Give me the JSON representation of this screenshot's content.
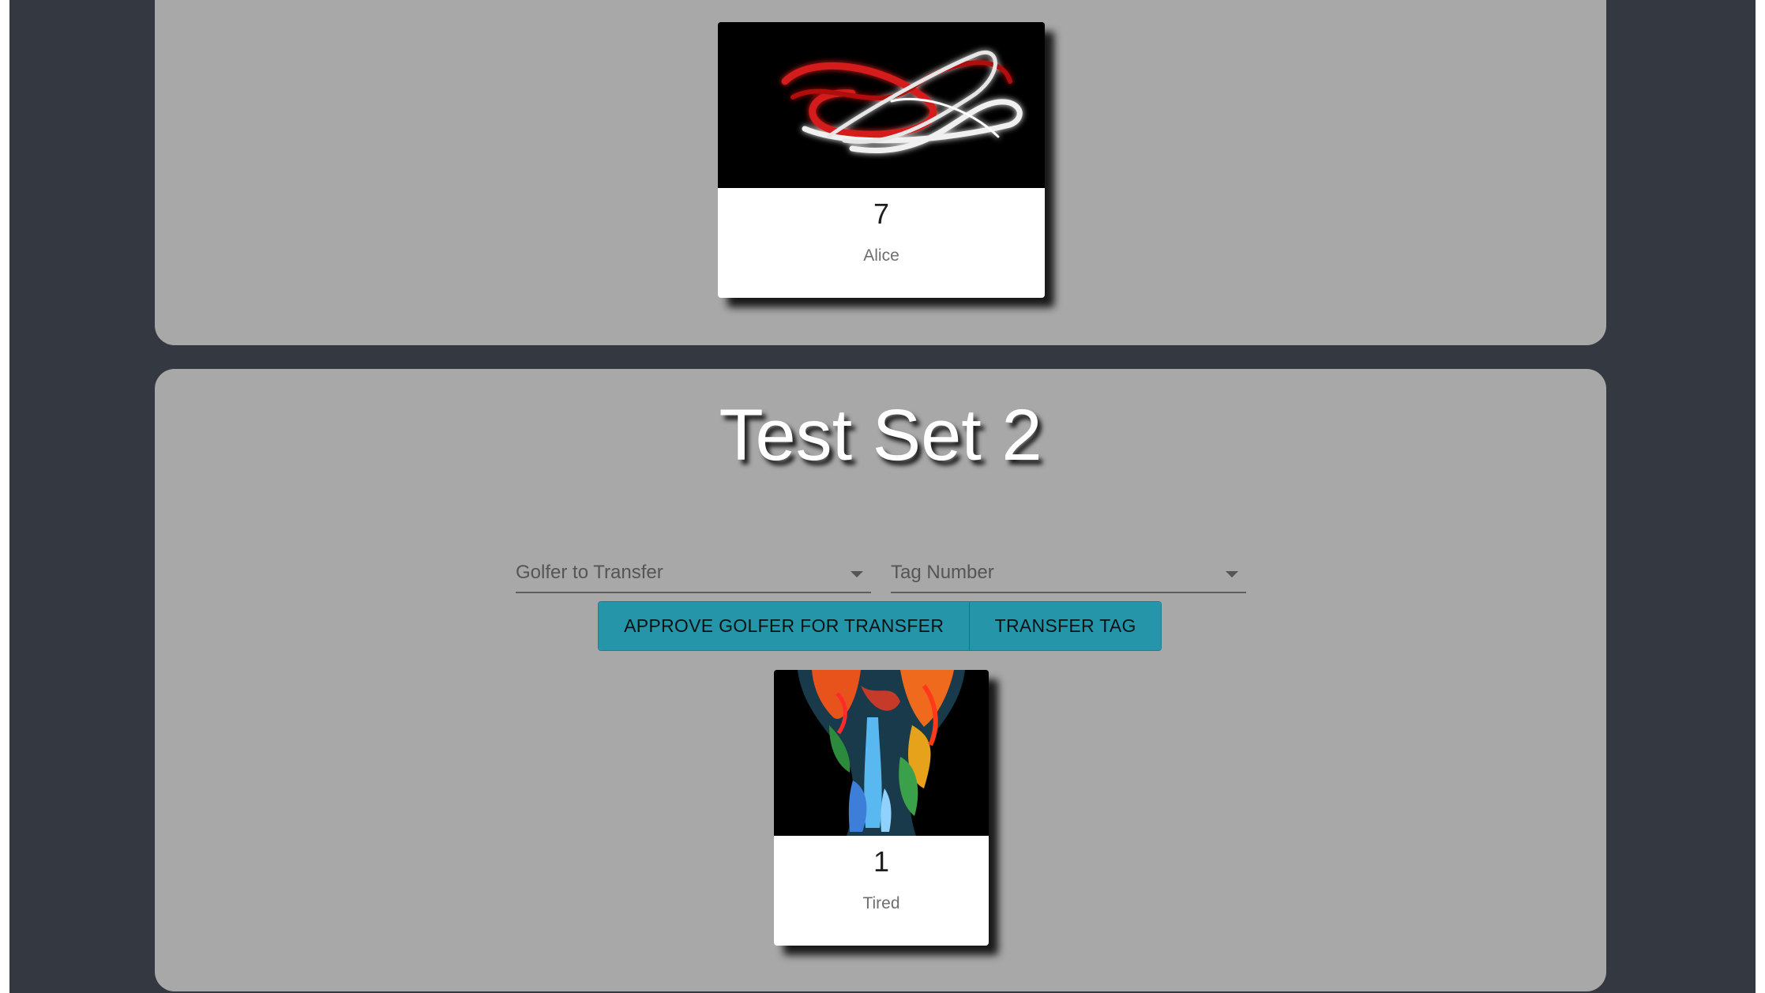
{
  "sets": [
    {
      "cards": [
        {
          "number": "7",
          "name": "Alice",
          "image": "light-painting-red-white-swirl"
        }
      ]
    },
    {
      "title": "Test Set 2",
      "selects": {
        "golfer": {
          "label": "Golfer to Transfer"
        },
        "tag": {
          "label": "Tag Number"
        }
      },
      "buttons": {
        "approve": "APPROVE GOLFER FOR TRANSFER",
        "transfer": "TRANSFER TAG"
      },
      "cards": [
        {
          "number": "1",
          "name": "Tired",
          "image": "neon-body-paint-waterfall"
        }
      ]
    }
  ],
  "colors": {
    "page_background": "#343840",
    "panel_background": "#a8a8a8",
    "button_accent": "#2596aa"
  }
}
